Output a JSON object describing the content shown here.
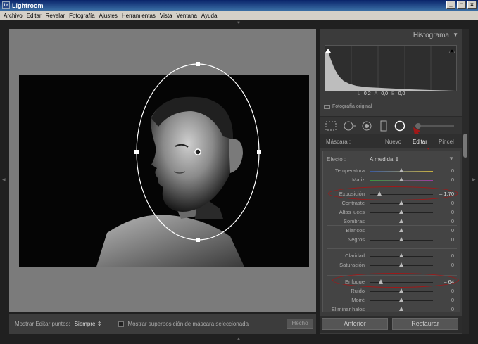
{
  "window": {
    "title": "Lightroom",
    "app_icon": "Lr",
    "buttons": [
      "_",
      "□",
      "×"
    ]
  },
  "menu": [
    "Archivo",
    "Editar",
    "Revelar",
    "Fotografía",
    "Ajustes",
    "Herramientas",
    "Vista",
    "Ventana",
    "Ayuda"
  ],
  "histogram": {
    "title": "Histograma",
    "stats": [
      "L",
      "0,2",
      "A",
      "0,0",
      "B",
      "0,0"
    ],
    "original_label": "Fotografía original"
  },
  "mask": {
    "label": "Máscara :",
    "options": [
      "Nuevo",
      "Editar",
      "Pincel"
    ]
  },
  "effect": {
    "label": "Efecto :",
    "value": "A medida"
  },
  "sliders": [
    {
      "label": "Temperatura",
      "value": "0",
      "pos": 0.5,
      "grad": "linear-gradient(90deg,#3a5aa0,#c8b040)"
    },
    {
      "label": "Matiz",
      "value": "0",
      "pos": 0.5,
      "grad": "linear-gradient(90deg,#3a9a3a,#a03aa0)"
    },
    {
      "label": "Exposición",
      "value": "– 1,70",
      "pos": 0.15,
      "highlight": true
    },
    {
      "label": "Contraste",
      "value": "0",
      "pos": 0.5
    },
    {
      "label": "Altas luces",
      "value": "0",
      "pos": 0.5
    },
    {
      "label": "Sombras",
      "value": "0",
      "pos": 0.5
    },
    {
      "label": "Blancos",
      "value": "0",
      "pos": 0.5
    },
    {
      "label": "Negros",
      "value": "0",
      "pos": 0.5
    },
    {
      "label": "Claridad",
      "value": "0",
      "pos": 0.5
    },
    {
      "label": "Saturación",
      "value": "0",
      "pos": 0.5
    },
    {
      "label": "Enfoque",
      "value": "– 64",
      "pos": 0.18,
      "highlight": true
    },
    {
      "label": "Ruido",
      "value": "0",
      "pos": 0.5
    },
    {
      "label": "Moiré",
      "value": "0",
      "pos": 0.5
    },
    {
      "label": "Eliminar halos",
      "value": "0",
      "pos": 0.5
    }
  ],
  "footer": {
    "show_points_label": "Mostrar Editar puntos:",
    "show_points_value": "Siempre",
    "overlay_label": "Mostrar superposición de máscara seleccionada",
    "done": "Hecho"
  },
  "buttons": {
    "previous": "Anterior",
    "reset": "Restaurar"
  },
  "colors": {
    "highlight": "#a01818"
  }
}
